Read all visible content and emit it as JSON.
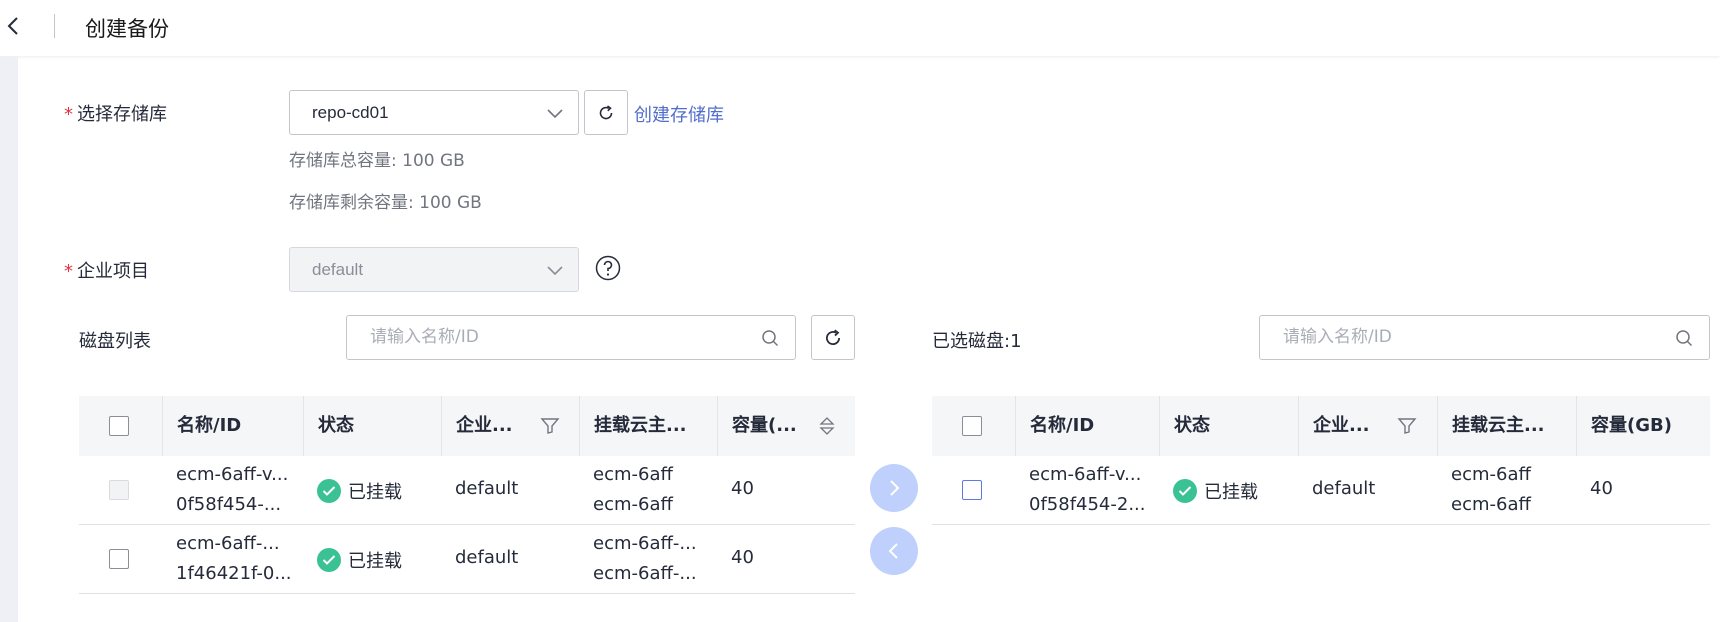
{
  "header": {
    "title": "创建备份"
  },
  "form": {
    "repo_label": "选择存储库",
    "repo_value": "repo-cd01",
    "create_repo_link": "创建存储库",
    "total_capacity": "存储库总容量: 100 GB",
    "remaining_capacity": "存储库剩余容量: 100 GB",
    "project_label": "企业项目",
    "project_value": "default",
    "required_mark": "*"
  },
  "disk_list": {
    "title": "磁盘列表",
    "search_placeholder": "请输入名称/ID",
    "columns": [
      "名称/ID",
      "状态",
      "企业...",
      "挂载云主...",
      "容量(..."
    ],
    "rows": [
      {
        "name_line1": "ecm-6aff-v...",
        "name_line2": "0f58f454-...",
        "status": "已挂载",
        "project": "default",
        "host_line1": "ecm-6aff",
        "host_line2": "ecm-6aff",
        "capacity": "40",
        "checkbox": "disabled"
      },
      {
        "name_line1": "ecm-6aff-...",
        "name_line2": "1f46421f-0...",
        "status": "已挂载",
        "project": "default",
        "host_line1": "ecm-6aff-...",
        "host_line2": "ecm-6aff-...",
        "capacity": "40",
        "checkbox": "unchecked"
      }
    ]
  },
  "selected_list": {
    "title": "已选磁盘:1",
    "search_placeholder": "请输入名称/ID",
    "columns": [
      "名称/ID",
      "状态",
      "企业...",
      "挂载云主...",
      "容量(GB)"
    ],
    "rows": [
      {
        "name_line1": "ecm-6aff-v...",
        "name_line2": "0f58f454-2...",
        "status": "已挂载",
        "project": "default",
        "host_line1": "ecm-6aff",
        "host_line2": "ecm-6aff",
        "capacity": "40",
        "checkbox": "unchecked"
      }
    ]
  },
  "colors": {
    "accent": "#526ecc",
    "success": "#3ac295",
    "required": "#e6313e",
    "move_button": "#bed0fb"
  },
  "icons": [
    "back-arrow-icon",
    "chevron-down-icon",
    "refresh-icon",
    "help-icon",
    "search-icon",
    "filter-icon",
    "sort-icon",
    "check-icon",
    "arrow-right-icon",
    "arrow-left-icon"
  ]
}
